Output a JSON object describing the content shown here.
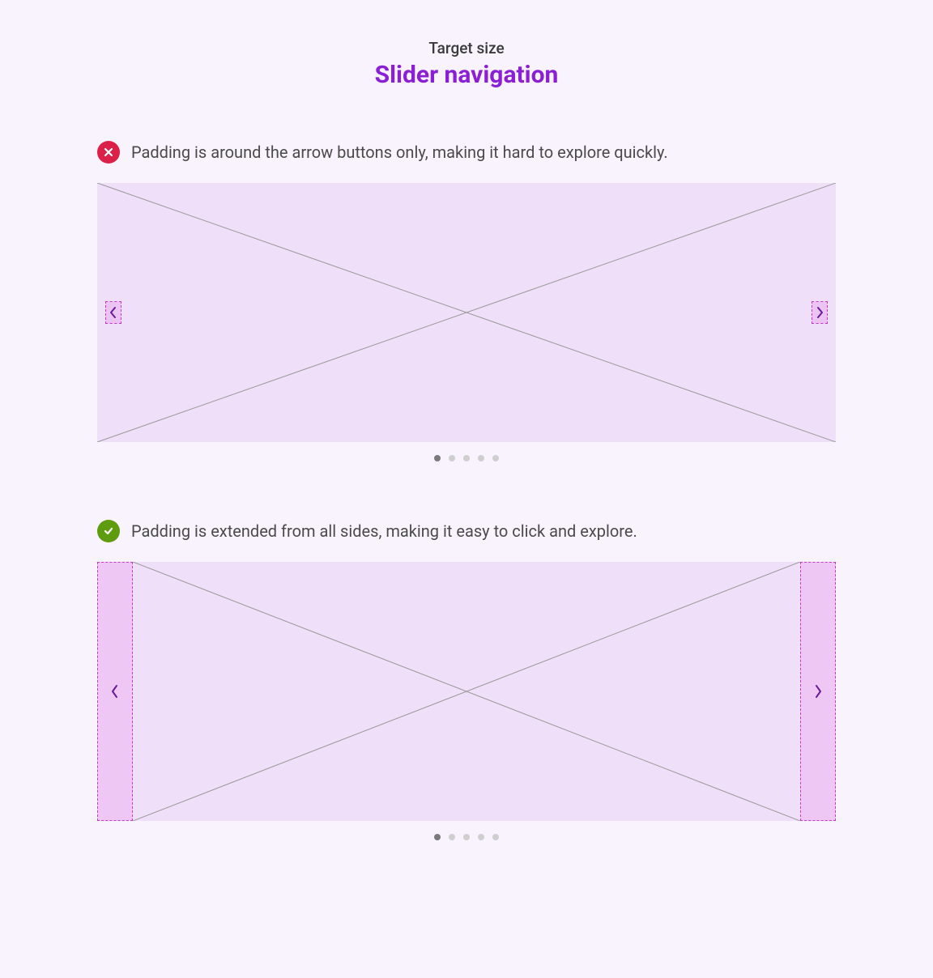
{
  "header": {
    "subtitle": "Target size",
    "title": "Slider navigation"
  },
  "examples": {
    "bad": {
      "text": "Padding is around the arrow buttons only, making it hard to explore quickly."
    },
    "good": {
      "text": "Padding is extended from all sides, making it easy to click and explore."
    }
  },
  "pagination": {
    "total": 5,
    "active_index": 0
  },
  "colors": {
    "bad_badge": "#dc2148",
    "good_badge": "#5f9b0f",
    "accent": "#8b1fd6",
    "slider_bg": "#f0dff9",
    "hit_area_bg": "rgba(232,170,240,0.5)",
    "hit_area_border": "#c339c9"
  }
}
